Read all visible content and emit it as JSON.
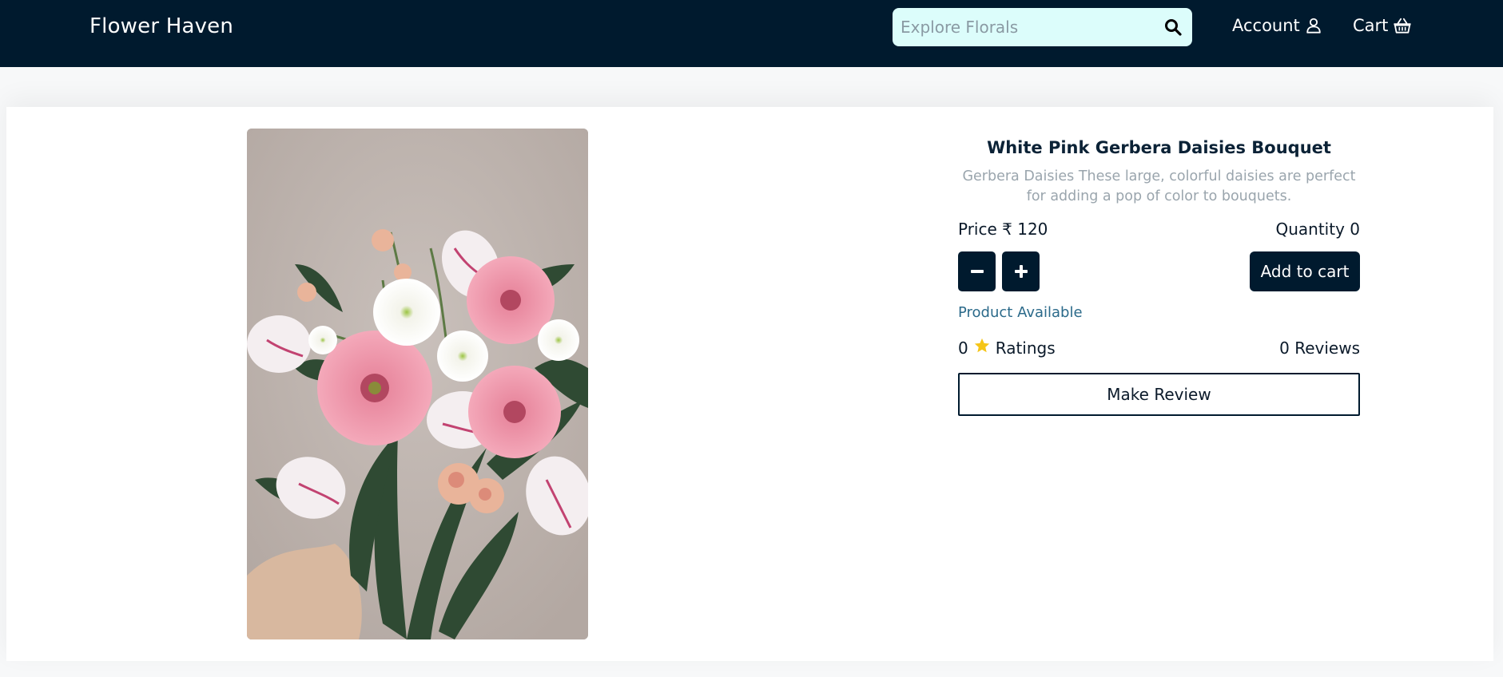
{
  "header": {
    "brand": "Flower Haven",
    "search": {
      "placeholder": "Explore Florals",
      "value": "",
      "icon": "search-icon"
    },
    "account_label": "Account",
    "account_icon": "user-icon",
    "cart_label": "Cart",
    "cart_icon": "basket-icon"
  },
  "product": {
    "image_icon": "bouquet-photo",
    "title": "White Pink Gerbera Daisies Bouquet",
    "description": "Gerbera Daisies These large, colorful daisies are perfect for adding a pop of color to bouquets.",
    "price_label": "Price ₹ 120",
    "quantity_label": "Quantity 0",
    "decrement_symbol": "−",
    "increment_symbol": "+",
    "add_to_cart_label": "Add to cart",
    "availability": "Product Available",
    "ratings_count": "0",
    "ratings_label": "Ratings",
    "star_icon": "star-icon",
    "reviews_label": "0 Reviews",
    "make_review_label": "Make Review"
  },
  "colors": {
    "navbar": "#001a2e",
    "search_bg": "#dcfdfb",
    "accent_text": "#2b6a8a",
    "star": "#f5c518"
  }
}
